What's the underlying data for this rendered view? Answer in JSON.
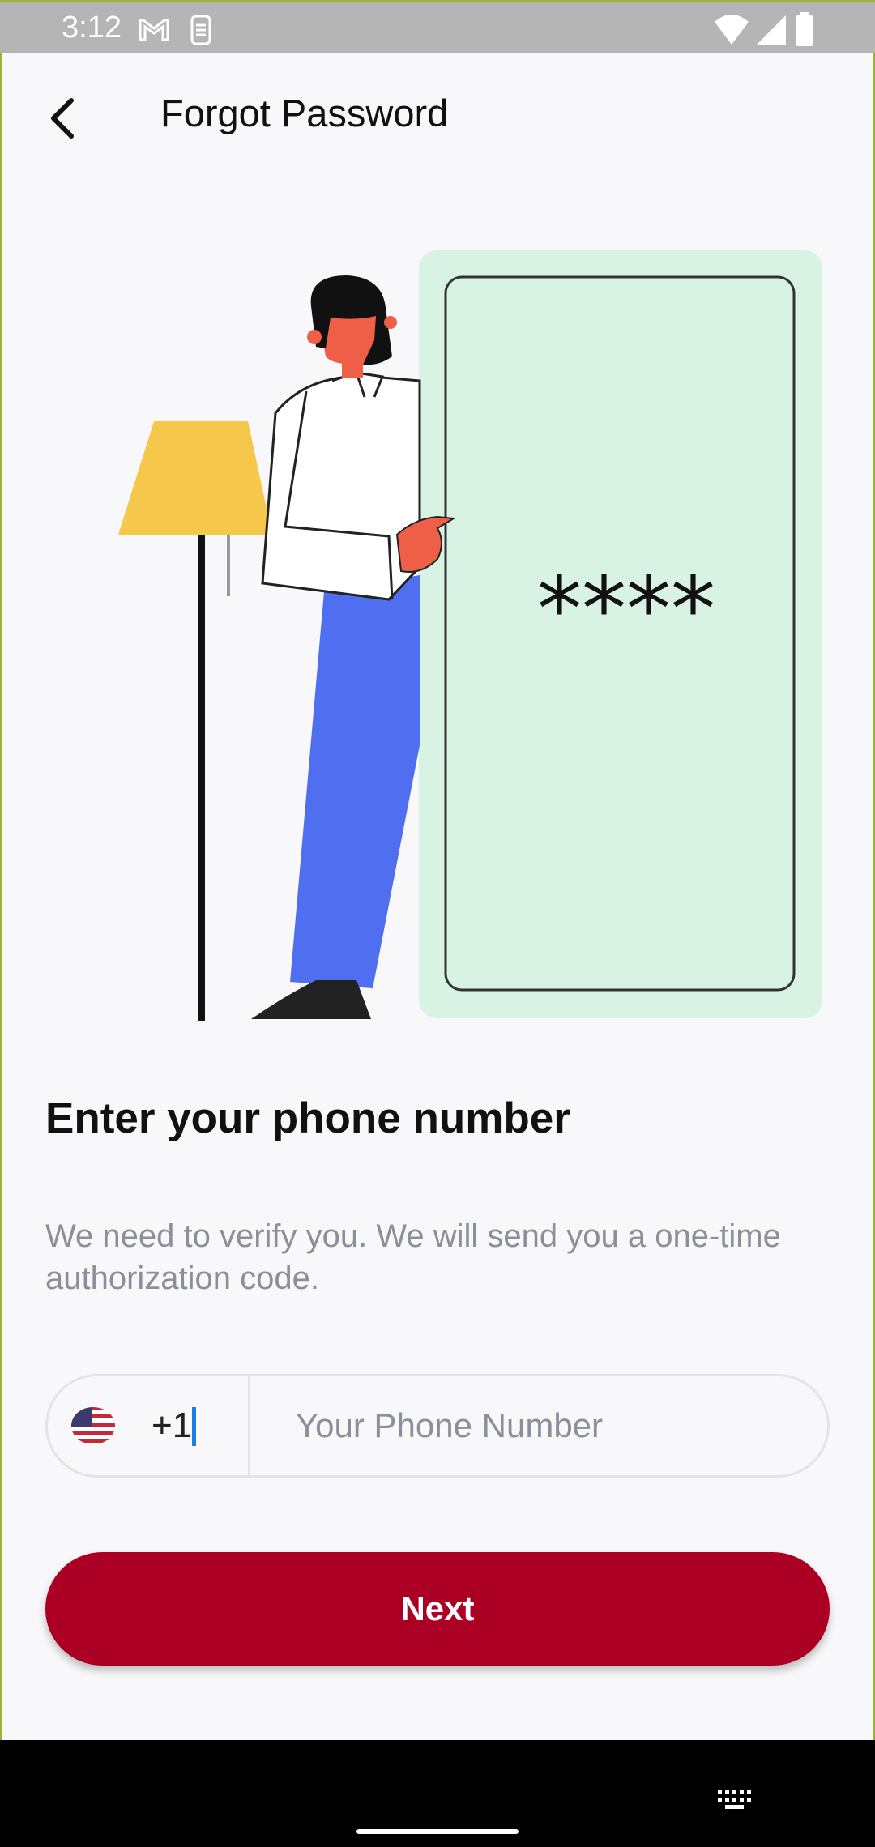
{
  "status_bar": {
    "time": "3:12",
    "icons": [
      "gmail-icon",
      "sim-icon",
      "wifi-icon",
      "signal-icon",
      "battery-icon"
    ]
  },
  "header": {
    "title": "Forgot Password",
    "back_icon": "chevron-left-icon"
  },
  "illustration": {
    "password_mask": "****"
  },
  "content": {
    "heading": "Enter your phone number",
    "description": "We need to verify you. We will send you a one-time authorization code."
  },
  "phone_field": {
    "country_flag": "us-flag-icon",
    "dial_code": "+1",
    "placeholder": "Your Phone Number",
    "value": ""
  },
  "actions": {
    "next_label": "Next"
  },
  "colors": {
    "primary": "#ab0024",
    "card_bg": "#d8f3e4",
    "lamp": "#f5c84b",
    "pants": "#4f6ef0",
    "skin": "#ef5f48"
  }
}
